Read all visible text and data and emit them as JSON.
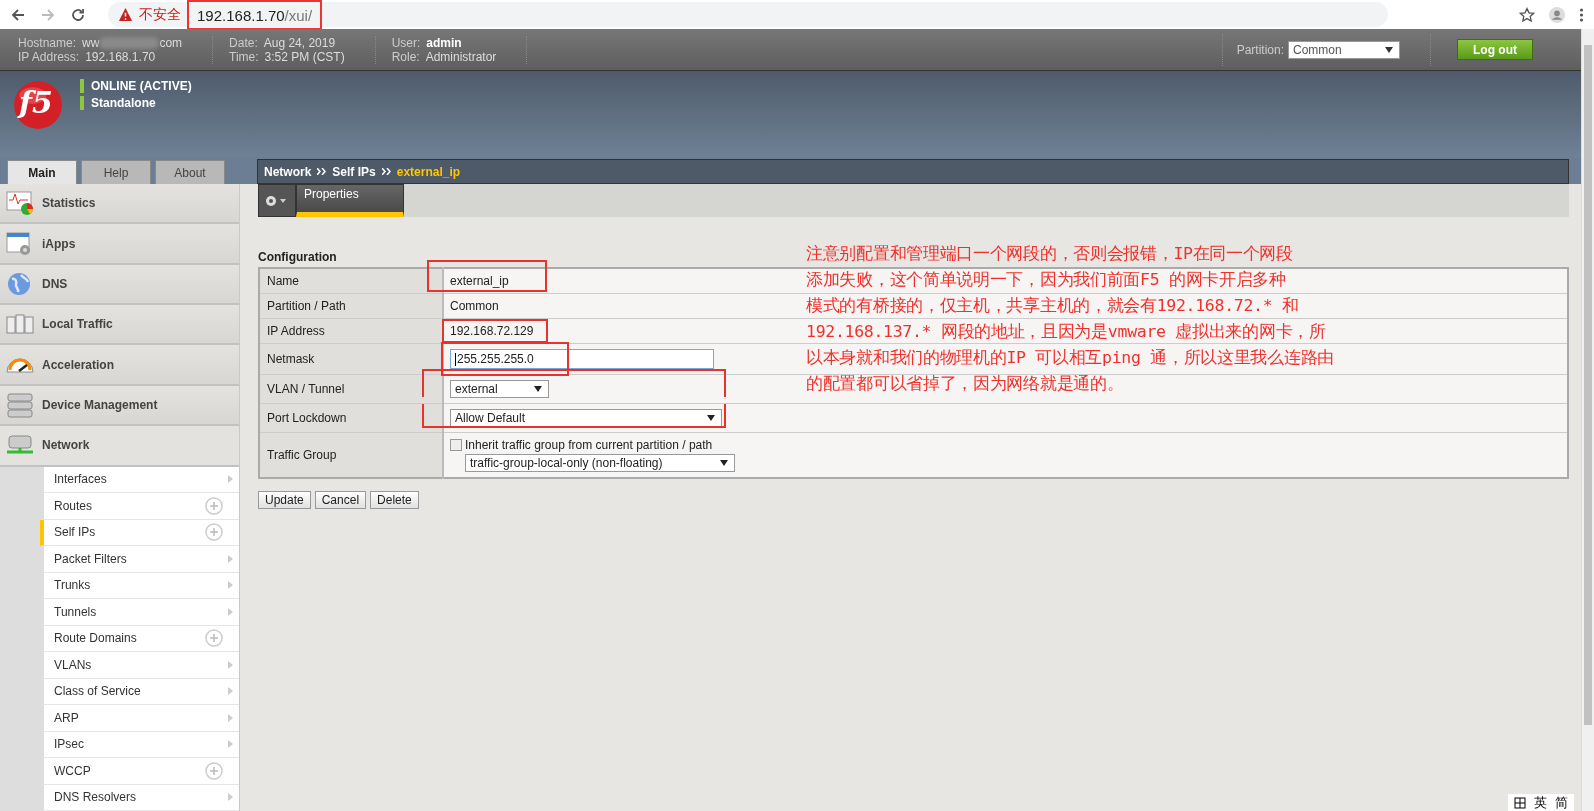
{
  "browser": {
    "security": "不安全",
    "url_host": "192.168.1.70",
    "url_path": "/xui/",
    "url_highlighted": true
  },
  "header": {
    "fields": [
      {
        "label": "Hostname:",
        "value_parts": [
          "ww",
          "com"
        ]
      },
      {
        "label": "IP Address:",
        "value_parts": [
          "192.168.1.70"
        ]
      },
      {
        "label": "Date:",
        "value_parts": [
          "Aug 24, 2019"
        ]
      },
      {
        "label": "Time:",
        "value_parts": [
          "3:52 PM (CST)"
        ]
      },
      {
        "label": "User:",
        "value_parts": [
          "admin"
        ]
      },
      {
        "label": "Role:",
        "value_parts": [
          "Administrator"
        ]
      }
    ],
    "partition_label": "Partition:",
    "partition": "Common",
    "logout": "Log out"
  },
  "status": [
    "ONLINE (ACTIVE)",
    "Standalone"
  ],
  "logo": "f5",
  "tabs": [
    {
      "label": "Main",
      "selected": true
    },
    {
      "label": "Help",
      "selected": false
    },
    {
      "label": "About",
      "selected": false
    }
  ],
  "sidebar": {
    "items": [
      {
        "label": "Statistics",
        "expanded": false
      },
      {
        "label": "iApps",
        "expanded": false
      },
      {
        "label": "DNS",
        "expanded": false
      },
      {
        "label": "Local Traffic",
        "expanded": false
      },
      {
        "label": "Acceleration",
        "expanded": false
      },
      {
        "label": "Device Management",
        "expanded": false
      },
      {
        "label": "Network",
        "expanded": true,
        "children": [
          {
            "label": "Interfaces",
            "kind": "arrow",
            "selected": false
          },
          {
            "label": "Routes",
            "kind": "add",
            "selected": false
          },
          {
            "label": "Self IPs",
            "kind": "add",
            "selected": true
          },
          {
            "label": "Packet Filters",
            "kind": "arrow",
            "selected": false
          },
          {
            "label": "Trunks",
            "kind": "arrow",
            "selected": false
          },
          {
            "label": "Tunnels",
            "kind": "arrow",
            "selected": false
          },
          {
            "label": "Route Domains",
            "kind": "add",
            "selected": false
          },
          {
            "label": "VLANs",
            "kind": "arrow",
            "selected": false
          },
          {
            "label": "Class of Service",
            "kind": "arrow",
            "selected": false
          },
          {
            "label": "ARP",
            "kind": "arrow",
            "selected": false
          },
          {
            "label": "IPsec",
            "kind": "arrow",
            "selected": false
          },
          {
            "label": "WCCP",
            "kind": "add",
            "selected": false
          },
          {
            "label": "DNS Resolvers",
            "kind": "arrow",
            "selected": false
          }
        ]
      }
    ]
  },
  "breadcrumb": [
    "Network",
    "Self IPs",
    "external_ip"
  ],
  "page_tabs": [
    {
      "label": "Properties",
      "selected": true
    }
  ],
  "section_title": "Configuration",
  "rows": [
    {
      "label": "Name",
      "kind": "text",
      "value": "external_ip",
      "highlighted": true
    },
    {
      "label": "Partition / Path",
      "kind": "text",
      "value": "Common",
      "highlighted": false
    },
    {
      "label": "IP Address",
      "kind": "text",
      "value": "192.168.72.129",
      "highlighted": true
    },
    {
      "label": "Netmask",
      "kind": "input",
      "value": "255.255.255.0",
      "highlighted": true
    },
    {
      "label": "VLAN / Tunnel",
      "kind": "select",
      "value": "external",
      "highlighted": true
    },
    {
      "label": "Port Lockdown",
      "kind": "select",
      "value": "Allow Default",
      "highlighted": true
    },
    {
      "label": "Traffic Group",
      "kind": "traffic",
      "checkbox_label": "Inherit traffic group from current partition / path",
      "checked": false,
      "value": "traffic-group-local-only (non-floating)",
      "highlighted": false
    }
  ],
  "buttons": [
    "Update",
    "Cancel",
    "Delete"
  ],
  "annotation": [
    "注意别配置和管理端口一个网段的，否则会报错，IP在同一个网段",
    "添加失败，这个简单说明一下，因为我们前面F5 的网卡开启多种",
    "模式的有桥接的，仅主机，共享主机的，就会有192.168.72.* 和",
    "192.168.137.* 网段的地址，且因为是vmware 虚拟出来的网卡，所",
    "以本身就和我们的物理机的IP 可以相互ping 通，所以这里我么连路由",
    "的配置都可以省掉了，因为网络就是通的。"
  ],
  "ime_bar": [
    "英",
    "简"
  ]
}
